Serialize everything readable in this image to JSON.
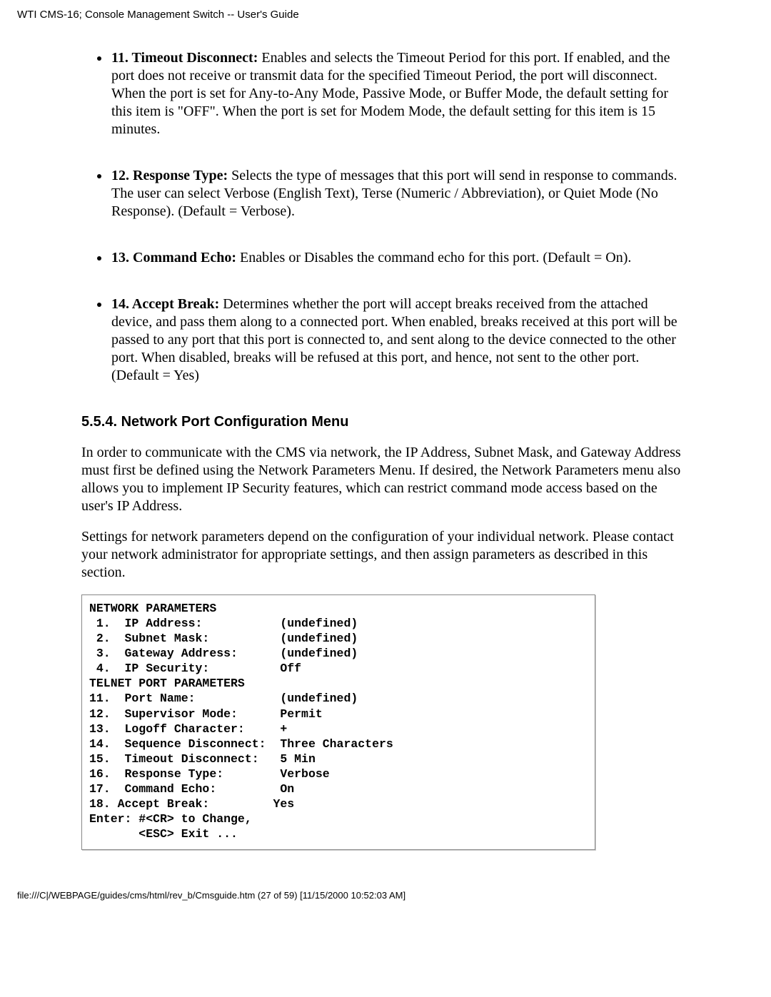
{
  "header": "WTI CMS-16; Console Management Switch -- User's Guide",
  "bullets": [
    {
      "title": "11.  Timeout Disconnect:",
      "body": "  Enables and selects the Timeout Period for this port.  If enabled, and the port does not receive or transmit data for the specified Timeout Period, the port will disconnect. When the port is set for Any-to-Any Mode, Passive Mode, or Buffer Mode, the default setting for this item is \"OFF\". When the port is set for Modem Mode, the default setting for this item is 15 minutes."
    },
    {
      "title": "12.  Response Type:",
      "body": "  Selects the type of messages that this port will send in response to commands.  The user can select Verbose (English Text), Terse (Numeric / Abbreviation), or Quiet Mode (No Response). (Default = Verbose)."
    },
    {
      "title": "13.  Command Echo:",
      "body": "  Enables or Disables the command echo for this port. (Default = On)."
    },
    {
      "title": "14.  Accept Break:",
      "body": "  Determines whether the port will accept breaks received from the attached device, and pass them along to a connected port. When enabled, breaks received at this port will be passed to any port that this port is connected to, and sent along to the device connected to the other port. When disabled, breaks will be refused at this port, and hence, not sent to the other port. (Default = Yes)"
    }
  ],
  "section": {
    "heading": "5.5.4.   Network Port Configuration Menu",
    "p1": "In order to communicate with the CMS via network, the IP Address, Subnet Mask, and Gateway Address must first be defined using the Network Parameters Menu. If desired, the Network Parameters menu also allows you to implement IP Security features, which can restrict command mode access based on the user's IP Address.",
    "p2": "Settings for network parameters depend on the configuration of your individual network. Please contact your network administrator for appropriate settings, and then assign parameters as described in this section."
  },
  "terminal": [
    "NETWORK PARAMETERS",
    " 1.  IP Address:           (undefined)",
    " 2.  Subnet Mask:          (undefined)",
    " 3.  Gateway Address:      (undefined)",
    " 4.  IP Security:          Off",
    "",
    "TELNET PORT PARAMETERS",
    "11.  Port Name:            (undefined)",
    "12.  Supervisor Mode:      Permit",
    "13.  Logoff Character:     +",
    "14.  Sequence Disconnect:  Three Characters",
    "15.  Timeout Disconnect:   5 Min",
    "16.  Response Type:        Verbose",
    "17.  Command Echo:         On",
    "18. Accept Break:         Yes",
    "",
    "Enter: #<CR> to Change,",
    "       <ESC> Exit ..."
  ],
  "footer": "file:///C|/WEBPAGE/guides/cms/html/rev_b/Cmsguide.htm (27 of 59) [11/15/2000 10:52:03 AM]"
}
